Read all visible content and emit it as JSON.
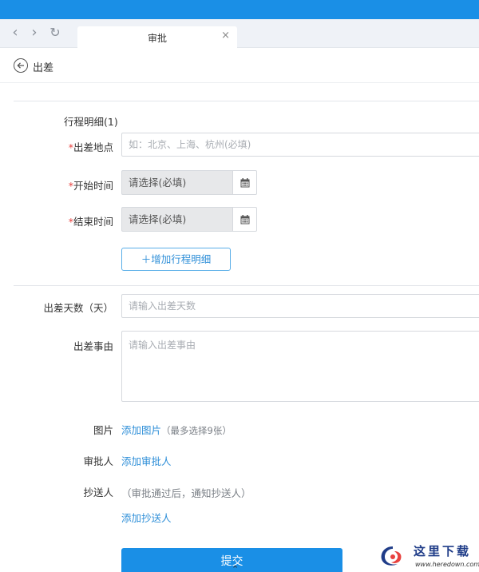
{
  "browser": {
    "tab_title": "审批",
    "tab_close": "×"
  },
  "header": {
    "title": "出差"
  },
  "itinerary": {
    "section_title": "行程明细(1)",
    "location": {
      "label": "出差地点",
      "placeholder": "如：北京、上海、杭州(必填)"
    },
    "start_time": {
      "label": "开始时间",
      "placeholder": "请选择(必填)"
    },
    "end_time": {
      "label": "结束时间",
      "placeholder": "请选择(必填)"
    },
    "required_mark": "*",
    "add_button": "＋增加行程明细"
  },
  "form": {
    "days": {
      "label": "出差天数（天）",
      "placeholder": "请输入出差天数"
    },
    "reason": {
      "label": "出差事由",
      "placeholder": "请输入出差事由"
    },
    "images": {
      "label": "图片",
      "link": "添加图片",
      "hint": "（最多选择9张）"
    },
    "approver": {
      "label": "审批人",
      "link": "添加审批人"
    },
    "cc": {
      "label": "抄送人",
      "hint": "（审批通过后，通知抄送人）",
      "link": "添加抄送人"
    },
    "submit": "提交"
  },
  "watermark": {
    "text": "这里下载",
    "url": "www.heredown.com"
  },
  "colors": {
    "primary": "#1a8fe6",
    "link": "#2f8fd8",
    "required": "#e8423f"
  }
}
